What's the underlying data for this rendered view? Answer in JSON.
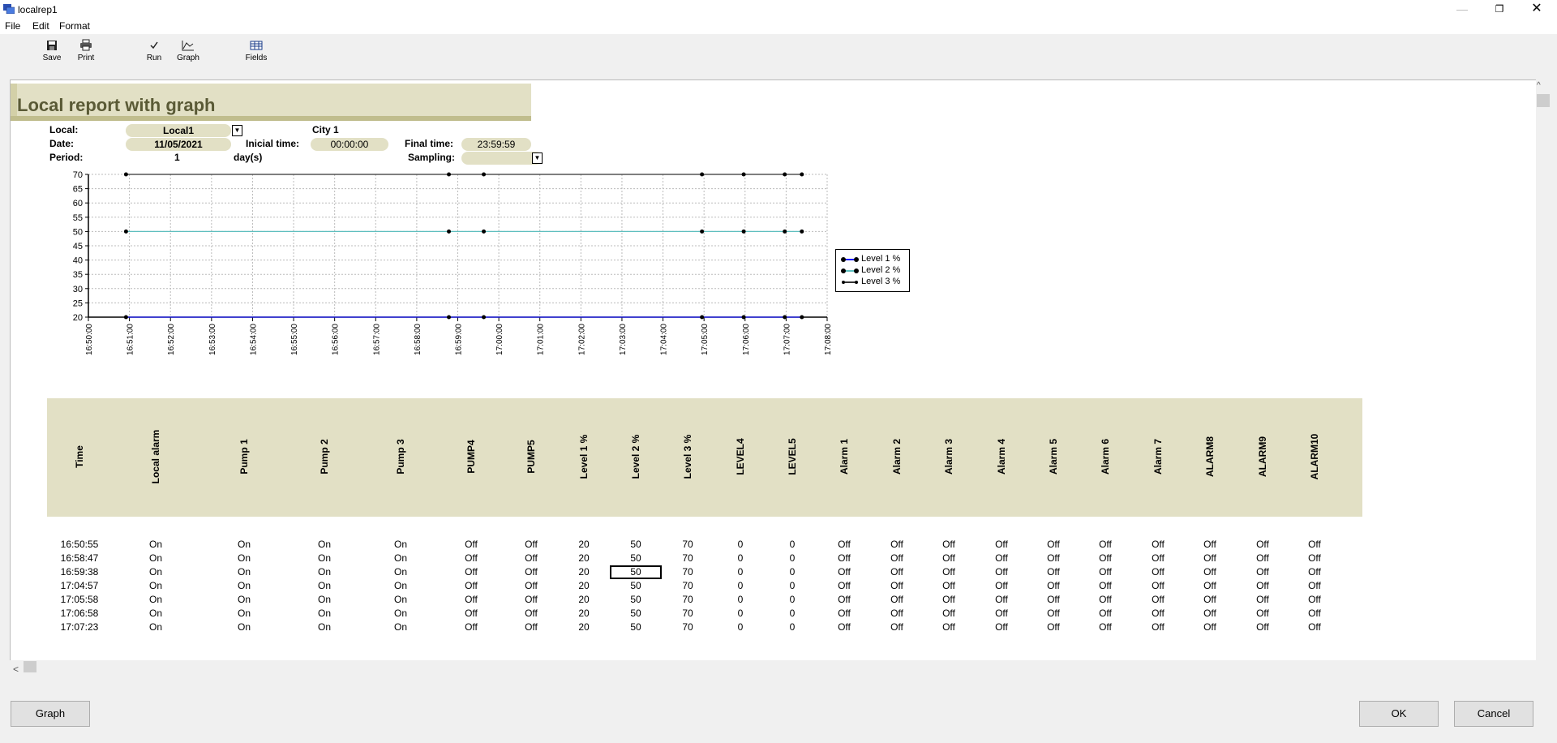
{
  "window": {
    "title": "localrep1",
    "minimize": "—",
    "maximize": "❐",
    "close": "✕"
  },
  "menu": [
    "File",
    "Edit",
    "Format"
  ],
  "toolbar": [
    {
      "label": "Save",
      "icon": "save-icon"
    },
    {
      "label": "Print",
      "icon": "print-icon"
    },
    {
      "label": "Run",
      "icon": "run-icon"
    },
    {
      "label": "Graph",
      "icon": "graph-icon"
    },
    {
      "label": "Fields",
      "icon": "fields-icon"
    }
  ],
  "report": {
    "title": "Local report with graph",
    "params": {
      "local_label": "Local:",
      "local_value": "Local1",
      "city": "City 1",
      "date_label": "Date:",
      "date_value": "11/05/2021",
      "initial_label": "Inicial time:",
      "initial_value": "00:00:00",
      "final_label": "Final time:",
      "final_value": "23:59:59",
      "period_label": "Period:",
      "period_value": "1",
      "period_unit": "day(s)",
      "sampling_label": "Sampling:",
      "sampling_value": ""
    }
  },
  "chart_data": {
    "type": "line",
    "title": "",
    "xlabel": "",
    "ylabel": "",
    "ylim": [
      20,
      70
    ],
    "y_ticks": [
      20,
      25,
      30,
      35,
      40,
      45,
      50,
      55,
      60,
      65,
      70
    ],
    "x_ticks": [
      "16:50:00",
      "16:51:00",
      "16:52:00",
      "16:53:00",
      "16:54:00",
      "16:55:00",
      "16:56:00",
      "16:57:00",
      "16:58:00",
      "16:59:00",
      "17:00:00",
      "17:01:00",
      "17:02:00",
      "17:03:00",
      "17:04:00",
      "17:05:00",
      "17:06:00",
      "17:07:00",
      "17:08:00"
    ],
    "x": [
      "16:50:55",
      "16:58:47",
      "16:59:38",
      "17:04:57",
      "17:05:58",
      "17:06:58",
      "17:07:23"
    ],
    "series": [
      {
        "name": "Level 1 %",
        "values": [
          20,
          20,
          20,
          20,
          20,
          20,
          20
        ],
        "color": "#1a1aff"
      },
      {
        "name": "Level 2 %",
        "values": [
          50,
          50,
          50,
          50,
          50,
          50,
          50
        ],
        "color": "#5fbfbf"
      },
      {
        "name": "Level 3 %",
        "values": [
          70,
          70,
          70,
          70,
          70,
          70,
          70
        ],
        "color": "#333333"
      }
    ],
    "grid": true,
    "legend": "right"
  },
  "table": {
    "columns": [
      "Time",
      "Local alarm",
      "Pump 1",
      "Pump 2",
      "Pump 3",
      "PUMP4",
      "PUMP5",
      "Level 1 %",
      "Level 2 %",
      "Level 3 %",
      "LEVEL4",
      "LEVEL5",
      "Alarm 1",
      "Alarm 2",
      "Alarm 3",
      "Alarm 4",
      "Alarm 5",
      "Alarm 6",
      "Alarm 7",
      "ALARM8",
      "ALARM9",
      "ALARM10"
    ],
    "rows": [
      [
        "16:50:55",
        "On",
        "On",
        "On",
        "On",
        "Off",
        "Off",
        "20",
        "50",
        "70",
        "0",
        "0",
        "Off",
        "Off",
        "Off",
        "Off",
        "Off",
        "Off",
        "Off",
        "Off",
        "Off",
        "Off"
      ],
      [
        "16:58:47",
        "On",
        "On",
        "On",
        "On",
        "Off",
        "Off",
        "20",
        "50",
        "70",
        "0",
        "0",
        "Off",
        "Off",
        "Off",
        "Off",
        "Off",
        "Off",
        "Off",
        "Off",
        "Off",
        "Off"
      ],
      [
        "16:59:38",
        "On",
        "On",
        "On",
        "On",
        "Off",
        "Off",
        "20",
        "50",
        "70",
        "0",
        "0",
        "Off",
        "Off",
        "Off",
        "Off",
        "Off",
        "Off",
        "Off",
        "Off",
        "Off",
        "Off"
      ],
      [
        "17:04:57",
        "On",
        "On",
        "On",
        "On",
        "Off",
        "Off",
        "20",
        "50",
        "70",
        "0",
        "0",
        "Off",
        "Off",
        "Off",
        "Off",
        "Off",
        "Off",
        "Off",
        "Off",
        "Off",
        "Off"
      ],
      [
        "17:05:58",
        "On",
        "On",
        "On",
        "On",
        "Off",
        "Off",
        "20",
        "50",
        "70",
        "0",
        "0",
        "Off",
        "Off",
        "Off",
        "Off",
        "Off",
        "Off",
        "Off",
        "Off",
        "Off",
        "Off"
      ],
      [
        "17:06:58",
        "On",
        "On",
        "On",
        "On",
        "Off",
        "Off",
        "20",
        "50",
        "70",
        "0",
        "0",
        "Off",
        "Off",
        "Off",
        "Off",
        "Off",
        "Off",
        "Off",
        "Off",
        "Off",
        "Off"
      ],
      [
        "17:07:23",
        "On",
        "On",
        "On",
        "On",
        "Off",
        "Off",
        "20",
        "50",
        "70",
        "0",
        "0",
        "Off",
        "Off",
        "Off",
        "Off",
        "Off",
        "Off",
        "Off",
        "Off",
        "Off",
        "Off"
      ]
    ]
  },
  "footer": {
    "graph_button": "Graph",
    "ok_button": "OK",
    "cancel_button": "Cancel"
  },
  "scroll": {
    "left_arrow": "<",
    "up_arrow": "^"
  }
}
